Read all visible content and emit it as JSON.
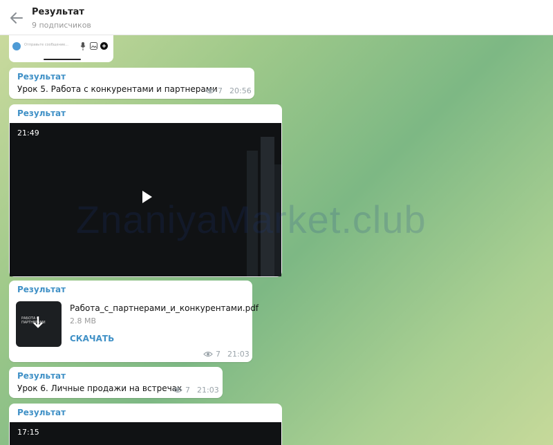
{
  "header": {
    "title": "Результат",
    "subtitle": "9 подписчиков"
  },
  "input_preview": {
    "placeholder": "Отправьте сообщение..."
  },
  "watermark": "ZnaniyaMarket.club",
  "messages": [
    {
      "sender": "Результат",
      "text": "Урок 5. Работа с конкурентами и партнерами",
      "views": "7",
      "time": "20:56"
    },
    {
      "sender": "Результат",
      "video_duration": "21:49"
    },
    {
      "sender": "Результат",
      "file_name": "Работа_с_партнерами_и_конкурентами.pdf",
      "file_size": "2.8 MB",
      "download_label": "СКАЧАТЬ",
      "thumb_text": "РАБОТА С ПАРТНЕРАМИ",
      "views": "7",
      "time": "21:03"
    },
    {
      "sender": "Результат",
      "text": "Урок 6. Личные продажи на встречах",
      "views": "7",
      "time": "21:03"
    },
    {
      "sender": "Результат",
      "video_duration": "17:15"
    }
  ],
  "colors": {
    "accent": "#3f90c6",
    "bubble": "#ffffff",
    "video_bg": "#101214"
  }
}
